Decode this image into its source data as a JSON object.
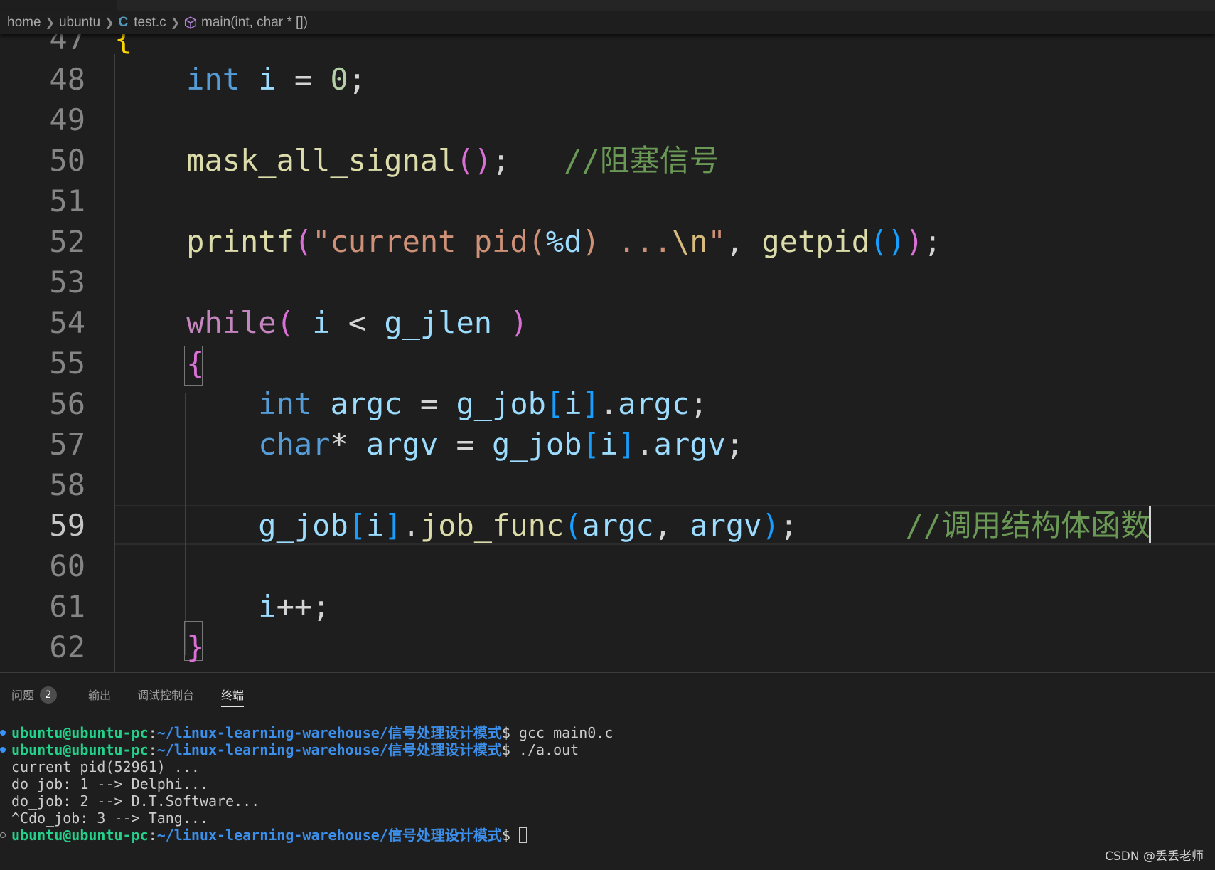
{
  "breadcrumb": {
    "home": "home",
    "ubuntu": "ubuntu",
    "file": "test.c",
    "symbol": "main(int, char * [])"
  },
  "editor": {
    "lines": [
      {
        "num": "47",
        "tokens": [
          {
            "t": "{",
            "c": "b1"
          }
        ]
      },
      {
        "num": "48",
        "tokens": [
          {
            "t": "    "
          },
          {
            "t": "int",
            "c": "kw"
          },
          {
            "t": " "
          },
          {
            "t": "i",
            "c": "var"
          },
          {
            "t": " = ",
            "c": "pun"
          },
          {
            "t": "0",
            "c": "num"
          },
          {
            "t": ";",
            "c": "pun"
          }
        ]
      },
      {
        "num": "49",
        "tokens": []
      },
      {
        "num": "50",
        "tokens": [
          {
            "t": "    "
          },
          {
            "t": "mask_all_signal",
            "c": "fn"
          },
          {
            "t": "()",
            "c": "b2"
          },
          {
            "t": ";",
            "c": "pun"
          },
          {
            "t": "   "
          },
          {
            "t": "//阻塞信号",
            "c": "cmt"
          }
        ]
      },
      {
        "num": "51",
        "tokens": []
      },
      {
        "num": "52",
        "tokens": [
          {
            "t": "    "
          },
          {
            "t": "printf",
            "c": "fn"
          },
          {
            "t": "(",
            "c": "b2"
          },
          {
            "t": "\"current pid(",
            "c": "str"
          },
          {
            "t": "%d",
            "c": "var"
          },
          {
            "t": ") ...",
            "c": "str"
          },
          {
            "t": "\\n",
            "c": "esc"
          },
          {
            "t": "\"",
            "c": "str"
          },
          {
            "t": ", ",
            "c": "pun"
          },
          {
            "t": "getpid",
            "c": "fn"
          },
          {
            "t": "()",
            "c": "b3"
          },
          {
            "t": ")",
            "c": "b2"
          },
          {
            "t": ";",
            "c": "pun"
          }
        ]
      },
      {
        "num": "53",
        "tokens": []
      },
      {
        "num": "54",
        "tokens": [
          {
            "t": "    "
          },
          {
            "t": "while",
            "c": "ctl"
          },
          {
            "t": "(",
            "c": "b2"
          },
          {
            "t": " "
          },
          {
            "t": "i",
            "c": "var"
          },
          {
            "t": " < ",
            "c": "pun"
          },
          {
            "t": "g_jlen",
            "c": "var"
          },
          {
            "t": " "
          },
          {
            "t": ")",
            "c": "b2"
          }
        ]
      },
      {
        "num": "55",
        "tokens": [
          {
            "t": "    "
          },
          {
            "t": "{",
            "c": "b2"
          }
        ]
      },
      {
        "num": "56",
        "tokens": [
          {
            "t": "        "
          },
          {
            "t": "int",
            "c": "kw"
          },
          {
            "t": " "
          },
          {
            "t": "argc",
            "c": "var"
          },
          {
            "t": " = ",
            "c": "pun"
          },
          {
            "t": "g_job",
            "c": "var"
          },
          {
            "t": "[",
            "c": "b3"
          },
          {
            "t": "i",
            "c": "var"
          },
          {
            "t": "]",
            "c": "b3"
          },
          {
            "t": ".",
            "c": "pun"
          },
          {
            "t": "argc",
            "c": "var"
          },
          {
            "t": ";",
            "c": "pun"
          }
        ]
      },
      {
        "num": "57",
        "tokens": [
          {
            "t": "        "
          },
          {
            "t": "char",
            "c": "kw"
          },
          {
            "t": "* ",
            "c": "pun"
          },
          {
            "t": "argv",
            "c": "var"
          },
          {
            "t": " = ",
            "c": "pun"
          },
          {
            "t": "g_job",
            "c": "var"
          },
          {
            "t": "[",
            "c": "b3"
          },
          {
            "t": "i",
            "c": "var"
          },
          {
            "t": "]",
            "c": "b3"
          },
          {
            "t": ".",
            "c": "pun"
          },
          {
            "t": "argv",
            "c": "var"
          },
          {
            "t": ";",
            "c": "pun"
          }
        ]
      },
      {
        "num": "58",
        "tokens": []
      },
      {
        "num": "59",
        "tokens": [
          {
            "t": "        "
          },
          {
            "t": "g_job",
            "c": "var"
          },
          {
            "t": "[",
            "c": "b3"
          },
          {
            "t": "i",
            "c": "var"
          },
          {
            "t": "]",
            "c": "b3"
          },
          {
            "t": ".",
            "c": "pun"
          },
          {
            "t": "job_func",
            "c": "fn"
          },
          {
            "t": "(",
            "c": "b3"
          },
          {
            "t": "argc",
            "c": "var"
          },
          {
            "t": ", ",
            "c": "pun"
          },
          {
            "t": "argv",
            "c": "var"
          },
          {
            "t": ")",
            "c": "b3"
          },
          {
            "t": ";",
            "c": "pun"
          },
          {
            "t": "      "
          },
          {
            "t": "//调用结构体函数",
            "c": "cmt"
          }
        ]
      },
      {
        "num": "60",
        "tokens": []
      },
      {
        "num": "61",
        "tokens": [
          {
            "t": "        "
          },
          {
            "t": "i",
            "c": "var"
          },
          {
            "t": "++;",
            "c": "pun"
          }
        ]
      },
      {
        "num": "62",
        "tokens": [
          {
            "t": "    "
          },
          {
            "t": "}",
            "c": "b2"
          }
        ]
      }
    ]
  },
  "panel": {
    "tabs": {
      "problems": "问题",
      "problems_count": "2",
      "output": "输出",
      "debug_console": "调试控制台",
      "terminal": "终端"
    },
    "terminal": {
      "prompt_user": "ubuntu@ubuntu-pc",
      "prompt_sep": ":",
      "prompt_path": "~/linux-learning-warehouse/信号处理设计模式",
      "prompt_dollar": "$ ",
      "cmd1": "gcc main0.c",
      "cmd2": "./a.out",
      "out1": "current pid(52961) ...",
      "out2": "do_job: 1 --> Delphi...",
      "out3": "do_job: 2 --> D.T.Software...",
      "out4": "^Cdo_job: 3 --> Tang..."
    }
  },
  "watermark": "CSDN @丢丢老师"
}
